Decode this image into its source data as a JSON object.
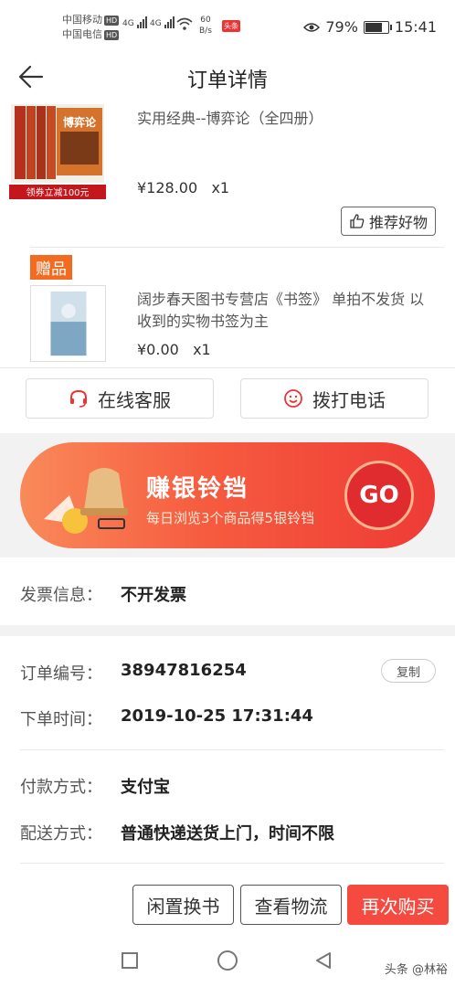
{
  "status_bar": {
    "carrier1": "中国移动",
    "carrier2": "中国电信",
    "hd": "HD",
    "sig1": "4G",
    "sig2": "4G",
    "speed_value": "60",
    "speed_unit": "B/s",
    "toutiao_badge": "头条",
    "battery": "79%",
    "battery_level": 0.79,
    "time": "15:41"
  },
  "nav": {
    "title": "订单详情",
    "back_icon": "arrow-left-icon"
  },
  "product1": {
    "title": "实用经典--博弈论（全四册）",
    "price": "¥128.00",
    "qty": "x1",
    "cover_title": "博弈论",
    "coupon_tag": "领券立减100元",
    "recommend_label": "推荐好物"
  },
  "gift": {
    "badge": "赠品",
    "title": "阔步春天图书专营店《书签》 单拍不发货 以收到的实物书签为主",
    "price": "¥0.00",
    "qty": "x1"
  },
  "service": {
    "chat_label": "在线客服",
    "call_label": "拨打电话"
  },
  "banner": {
    "title": "赚银铃铛",
    "subtitle": "每日浏览3个商品得5银铃铛",
    "go_label": "GO"
  },
  "invoice": {
    "label": "发票信息：",
    "value": "不开发票"
  },
  "order": {
    "number_label": "订单编号：",
    "number": "38947816254",
    "copy_label": "复制",
    "time_label": "下单时间：",
    "time": "2019-10-25 17:31:44"
  },
  "payment": {
    "label": "付款方式：",
    "value": "支付宝"
  },
  "delivery": {
    "label": "配送方式：",
    "value": "普通快递送货上门，时间不限"
  },
  "actions": {
    "swap_label": "闲置换书",
    "logistics_label": "查看物流",
    "rebuy_label": "再次购买"
  },
  "watermark": "头条 @林裕",
  "colors": {
    "accent": "#f44a3f",
    "gift_badge": "#f36b21"
  }
}
